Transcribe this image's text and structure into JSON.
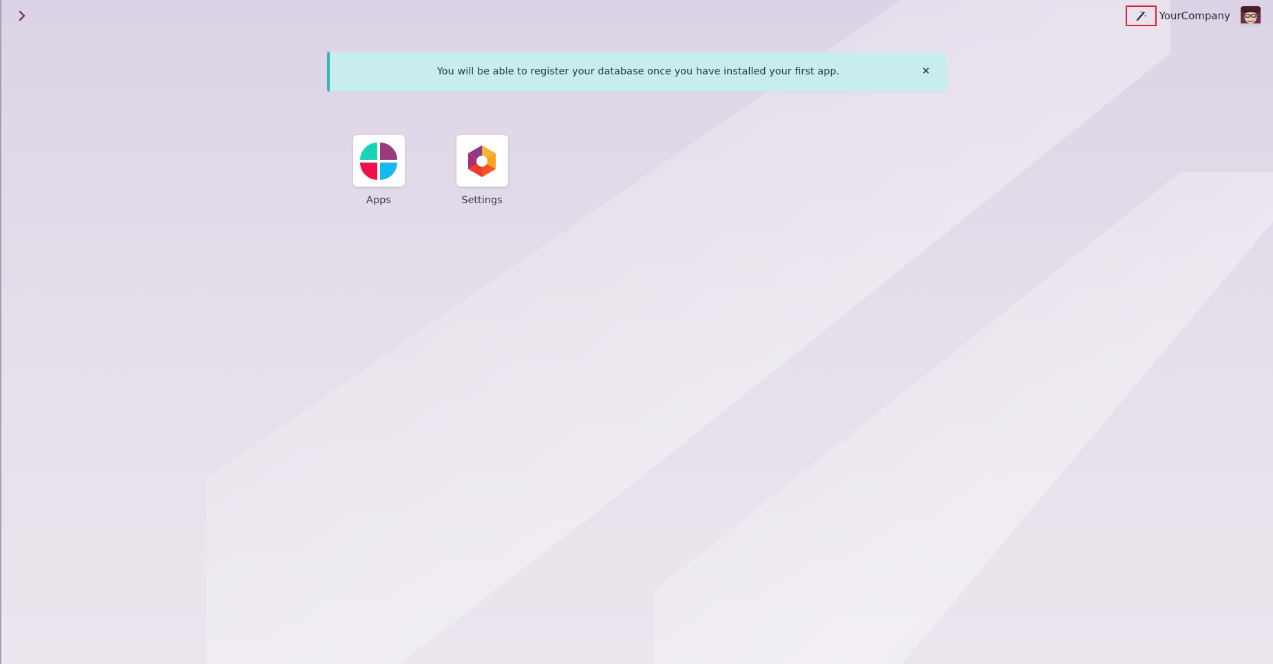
{
  "topbar": {
    "menu_toggle_icon": "chevron-right-icon",
    "debug_icon": "magic-wand-icon",
    "company_name": "YourCompany",
    "avatar_icon": "user-avatar-icon"
  },
  "alert": {
    "message": "You will be able to register your database once you have installed your first app.",
    "close_label": "×",
    "color": "#c7edee",
    "accent_color": "#39b4bd"
  },
  "apps": [
    {
      "label": "Apps",
      "icon": "apps-icon"
    },
    {
      "label": "Settings",
      "icon": "settings-icon"
    }
  ],
  "colors": {
    "chevron": "#7c3a5e",
    "debug_highlight": "#e0202a"
  }
}
